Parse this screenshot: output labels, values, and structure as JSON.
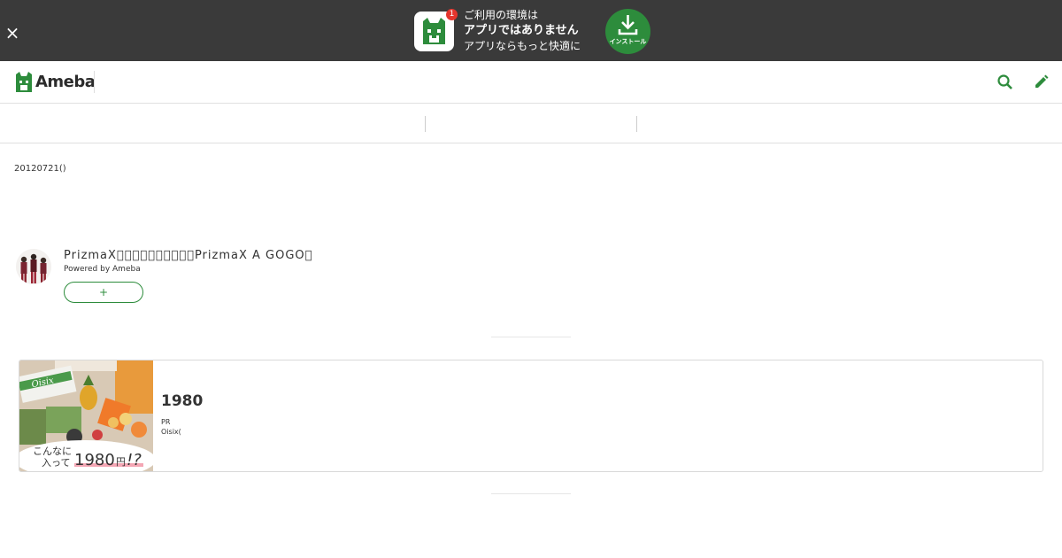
{
  "banner": {
    "close_label": "×",
    "badge_count": "1",
    "line1": "ご利用の環境は",
    "line2": "アプリではありません",
    "line3": "アプリならもっと快適に",
    "install_label": "インストール"
  },
  "header": {
    "logo_text": "Ameba",
    "search_icon": "search-icon",
    "edit_icon": "pencil-icon"
  },
  "entry": {
    "date": "20120721()"
  },
  "profile": {
    "blog_title": "PrizmaX\u0000\u0000\u0000\u0000\u0000\u0000\u0000\u0000\u0000\u0000PrizmaX A GOGO\u0000",
    "powered_by": "Powered by Ameba",
    "follow_label": "+"
  },
  "ad": {
    "headline": "1980",
    "pr_label": "PR",
    "source": "Oisix(",
    "image_caption_1": "こんなに",
    "image_caption_2": "入って",
    "image_price": "1980",
    "image_yen": "円",
    "image_exclaim": "!?",
    "image_brand": "Oisix"
  },
  "colors": {
    "banner_bg": "#3a3a3a",
    "accent_green": "#2d8c3c",
    "badge_red": "#e5352d"
  }
}
